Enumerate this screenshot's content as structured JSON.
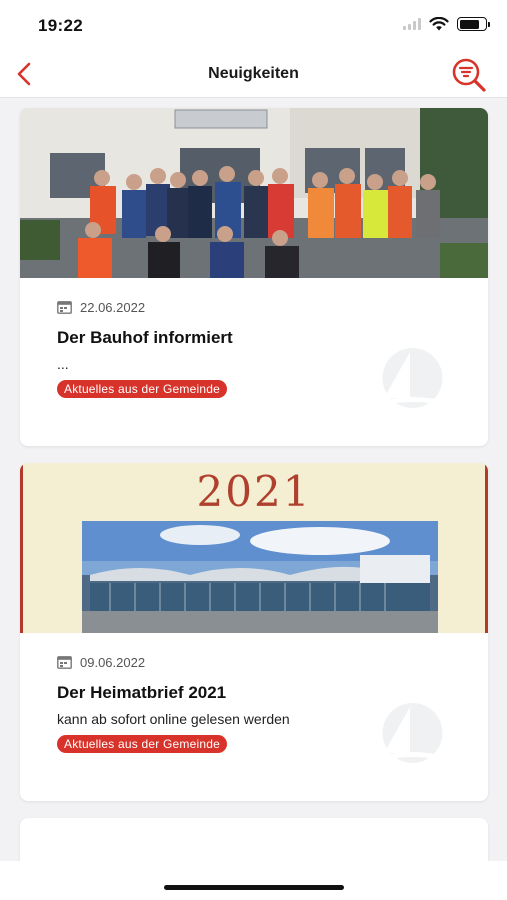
{
  "status_bar": {
    "time": "19:22",
    "icons": [
      "cellular-signal-icon",
      "wifi-icon",
      "battery-icon"
    ]
  },
  "nav": {
    "title": "Neuigkeiten",
    "back_icon": "chevron-left-icon",
    "action_icon": "filter-search-icon",
    "accent_color": "#d8332a"
  },
  "news": [
    {
      "image": "group-photo-bauhof-staff",
      "date": "22.06.2022",
      "title": "Der Bauhof informiert",
      "excerpt": "...",
      "category": "Aktuelles aus der Gemeinde"
    },
    {
      "image": "heimatbrief-2021-cover",
      "image_caption": "2021",
      "date": "09.06.2022",
      "title": "Der Heimatbrief 2021",
      "excerpt": "kann ab sofort online gelesen werden",
      "category": "Aktuelles aus der Gemeinde"
    }
  ]
}
